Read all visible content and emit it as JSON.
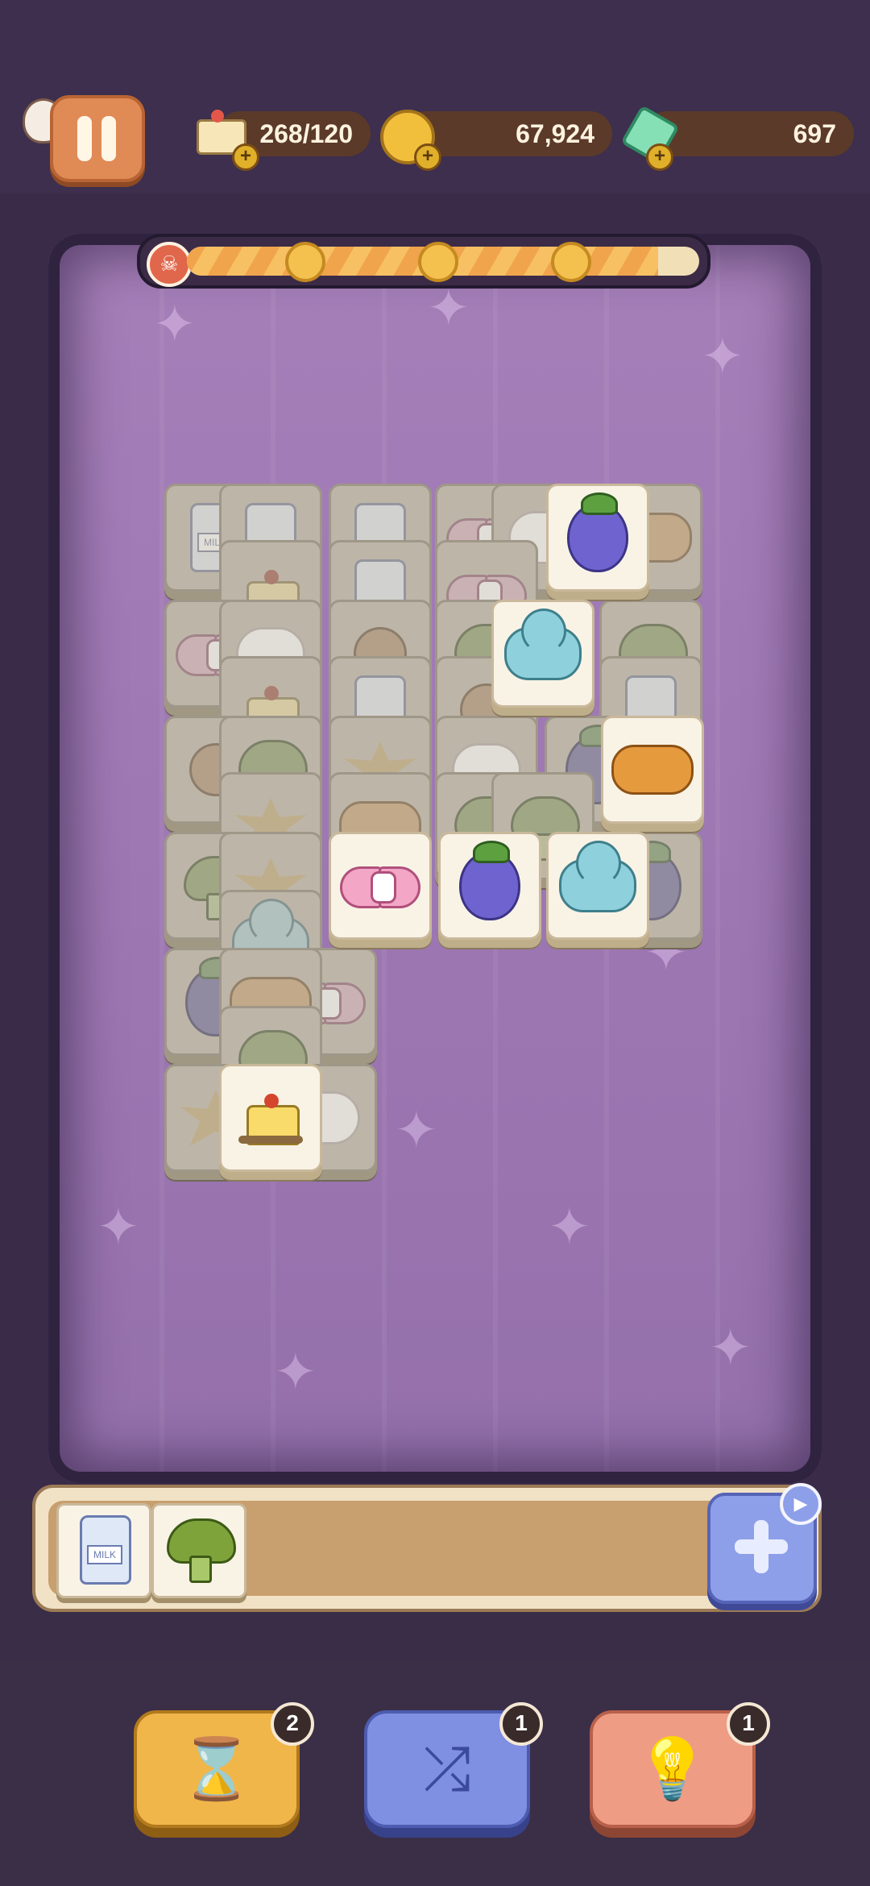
{
  "hud": {
    "cake_count": "268/120",
    "coins": "67,924",
    "gems": "697",
    "level_progress": 0.92
  },
  "icons": {
    "pause": "pause-icon",
    "cake": "cake-icon",
    "coin": "coin-icon",
    "gem": "gem-icon",
    "skull": "skull-icon",
    "add": "plus-icon",
    "play": "play-icon"
  },
  "tray": {
    "slots": [
      "milk",
      "broccoli"
    ],
    "milk_label": "MILK"
  },
  "powerups": {
    "undo_count": "2",
    "shuffle_count": "1",
    "hint_count": "1"
  },
  "colors": {
    "undo": "#f0b64a",
    "shuffle": "#7f8fe2",
    "hint": "#ef9c84"
  }
}
